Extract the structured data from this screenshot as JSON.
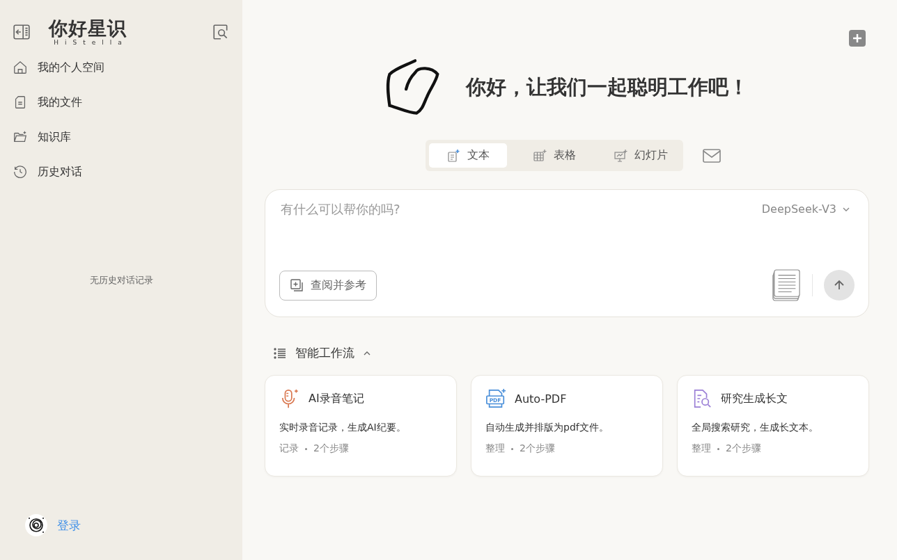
{
  "sidebar": {
    "logo": {
      "title": "你好星识",
      "subtitle": "HiStella"
    },
    "items": [
      {
        "label": "我的个人空间",
        "kind": "home"
      },
      {
        "label": "我的文件",
        "kind": "file"
      },
      {
        "label": "知识库",
        "kind": "folder"
      },
      {
        "label": "历史对话",
        "kind": "history"
      }
    ],
    "empty_text": "无历史对话记录",
    "login": "登录"
  },
  "greeting": "你好，让我们一起聪明工作吧！",
  "tabs": [
    {
      "label": "文本",
      "kind": "text",
      "selected": true
    },
    {
      "label": "表格",
      "kind": "table",
      "selected": false
    },
    {
      "label": "幻灯片",
      "kind": "slides",
      "selected": false
    }
  ],
  "composer": {
    "placeholder": "有什么可以帮你的吗?",
    "model": "DeepSeek-V3",
    "reference_button": "查阅并参考"
  },
  "workflow": {
    "title": "智能工作流",
    "expanded": true,
    "cards": [
      {
        "kind": "mic",
        "color": "#d9774f",
        "title": "AI录音笔记",
        "description": "实时录音记录，生成AI纪要。",
        "category": "记录",
        "steps": "2个步骤"
      },
      {
        "kind": "pdf",
        "color": "#4a8fd9",
        "icon_label": "PDF",
        "title": "Auto-PDF",
        "description": "自动生成并排版为pdf文件。",
        "category": "整理",
        "steps": "2个步骤"
      },
      {
        "kind": "research",
        "color": "#9b7fd6",
        "title": "研究生成长文",
        "description": "全局搜索研究，生成长文本。",
        "category": "整理",
        "steps": "2个步骤"
      }
    ]
  }
}
